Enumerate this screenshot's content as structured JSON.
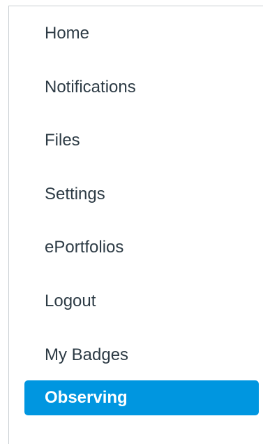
{
  "account_nav": {
    "items": [
      {
        "label": "Home"
      },
      {
        "label": "Notifications"
      },
      {
        "label": "Files"
      },
      {
        "label": "Settings"
      },
      {
        "label": "ePortfolios"
      },
      {
        "label": "Logout"
      },
      {
        "label": "My Badges"
      },
      {
        "label": "Observing",
        "active": true
      }
    ],
    "colors": {
      "active_background": "#0096e0",
      "active_text": "#ffffff",
      "text": "#2d3b45",
      "border": "#c7cdd1"
    }
  }
}
